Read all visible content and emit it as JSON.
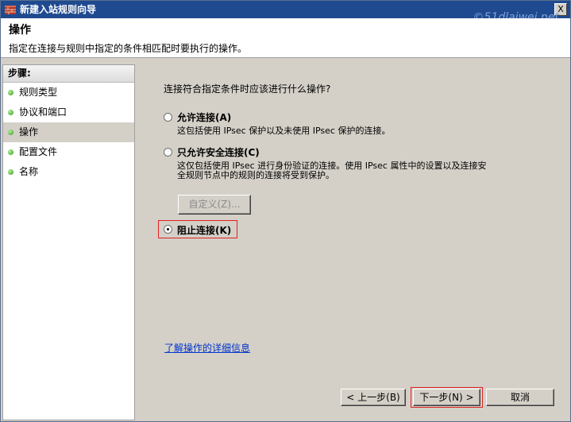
{
  "window": {
    "title": "新建入站规则向导",
    "close_label": "X",
    "watermark": "©51dlaiwei.net"
  },
  "header": {
    "title": "操作",
    "subtitle": "指定在连接与规则中指定的条件相匹配时要执行的操作。"
  },
  "sidebar": {
    "heading": "步骤:",
    "items": [
      {
        "label": "规则类型"
      },
      {
        "label": "协议和端口"
      },
      {
        "label": "操作"
      },
      {
        "label": "配置文件"
      },
      {
        "label": "名称"
      }
    ]
  },
  "main": {
    "question": "连接符合指定条件时应该进行什么操作?",
    "options": [
      {
        "label": "允许连接(A)",
        "desc": "这包括使用 IPsec 保护以及未使用 IPsec 保护的连接。",
        "selected": false
      },
      {
        "label": "只允许安全连接(C)",
        "desc_line1": "这仅包括使用 IPsec 进行身份验证的连接。使用 IPsec 属性中的设置以及连接安",
        "desc_line2": "全规则节点中的规则的连接将受到保护。",
        "selected": false
      },
      {
        "label": "阻止连接(K)",
        "selected": true
      }
    ],
    "customize_label": "自定义(Z)...",
    "learn_more_link": "了解操作的详细信息"
  },
  "footer": {
    "back_label": "< 上一步(B)",
    "next_label": "下一步(N) >",
    "cancel_label": "取消"
  }
}
